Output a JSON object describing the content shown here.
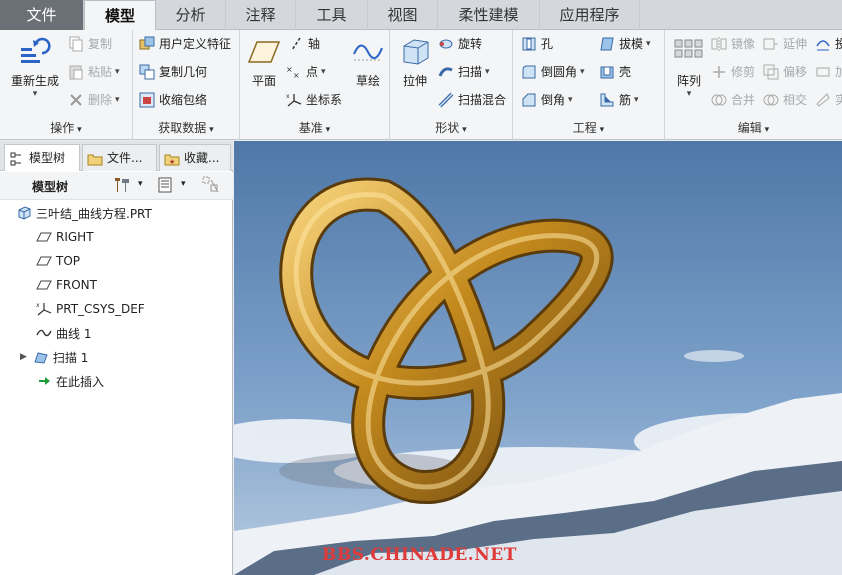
{
  "tabs": [
    "文件",
    "模型",
    "分析",
    "注释",
    "工具",
    "视图",
    "柔性建模",
    "应用程序"
  ],
  "active_tab": "模型",
  "ribbon": {
    "ops": {
      "label": "操作",
      "regen": "重新生成",
      "copy": "复制",
      "paste": "粘贴",
      "delete": "删除"
    },
    "get": {
      "label": "获取数据",
      "udf": "用户定义特征",
      "copygeom": "复制几何",
      "shrink": "收缩包络"
    },
    "datum": {
      "label": "基准",
      "plane": "平面",
      "axis": "轴",
      "point": "点",
      "csys": "坐标系",
      "sketch": "草绘"
    },
    "shape": {
      "label": "形状",
      "extrude": "拉伸",
      "revolve": "旋转",
      "sweep": "扫描",
      "swept_blend": "扫描混合"
    },
    "eng": {
      "label": "工程",
      "hole": "孔",
      "round": "倒圆角",
      "chamfer": "倒角",
      "draft": "拔模",
      "shell": "壳",
      "rib": "筋"
    },
    "edit": {
      "label": "编辑",
      "pattern": "阵列",
      "mirror": "镜像",
      "trim": "修剪",
      "merge": "合并",
      "extend": "延伸",
      "offset": "偏移",
      "intersect": "相交",
      "cut3": "投",
      "cut4": "加",
      "cut5": "实"
    }
  },
  "left_panel": {
    "tabs": [
      "模型树",
      "文件...",
      "收藏..."
    ],
    "toolbar_title": "模型树",
    "tree": [
      {
        "label": "三叶结_曲线方程.PRT",
        "icon": "part-icon"
      },
      {
        "label": "RIGHT",
        "icon": "datum-plane-icon"
      },
      {
        "label": "TOP",
        "icon": "datum-plane-icon"
      },
      {
        "label": "FRONT",
        "icon": "datum-plane-icon"
      },
      {
        "label": "PRT_CSYS_DEF",
        "icon": "csys-icon"
      },
      {
        "label": "曲线 1",
        "icon": "curve-icon"
      },
      {
        "label": "扫描 1",
        "icon": "sweep-icon"
      },
      {
        "label": "在此插入",
        "icon": "insert-arrow-icon"
      }
    ]
  },
  "viewport": {
    "watermark": "BBS.CHINADE.NET"
  }
}
